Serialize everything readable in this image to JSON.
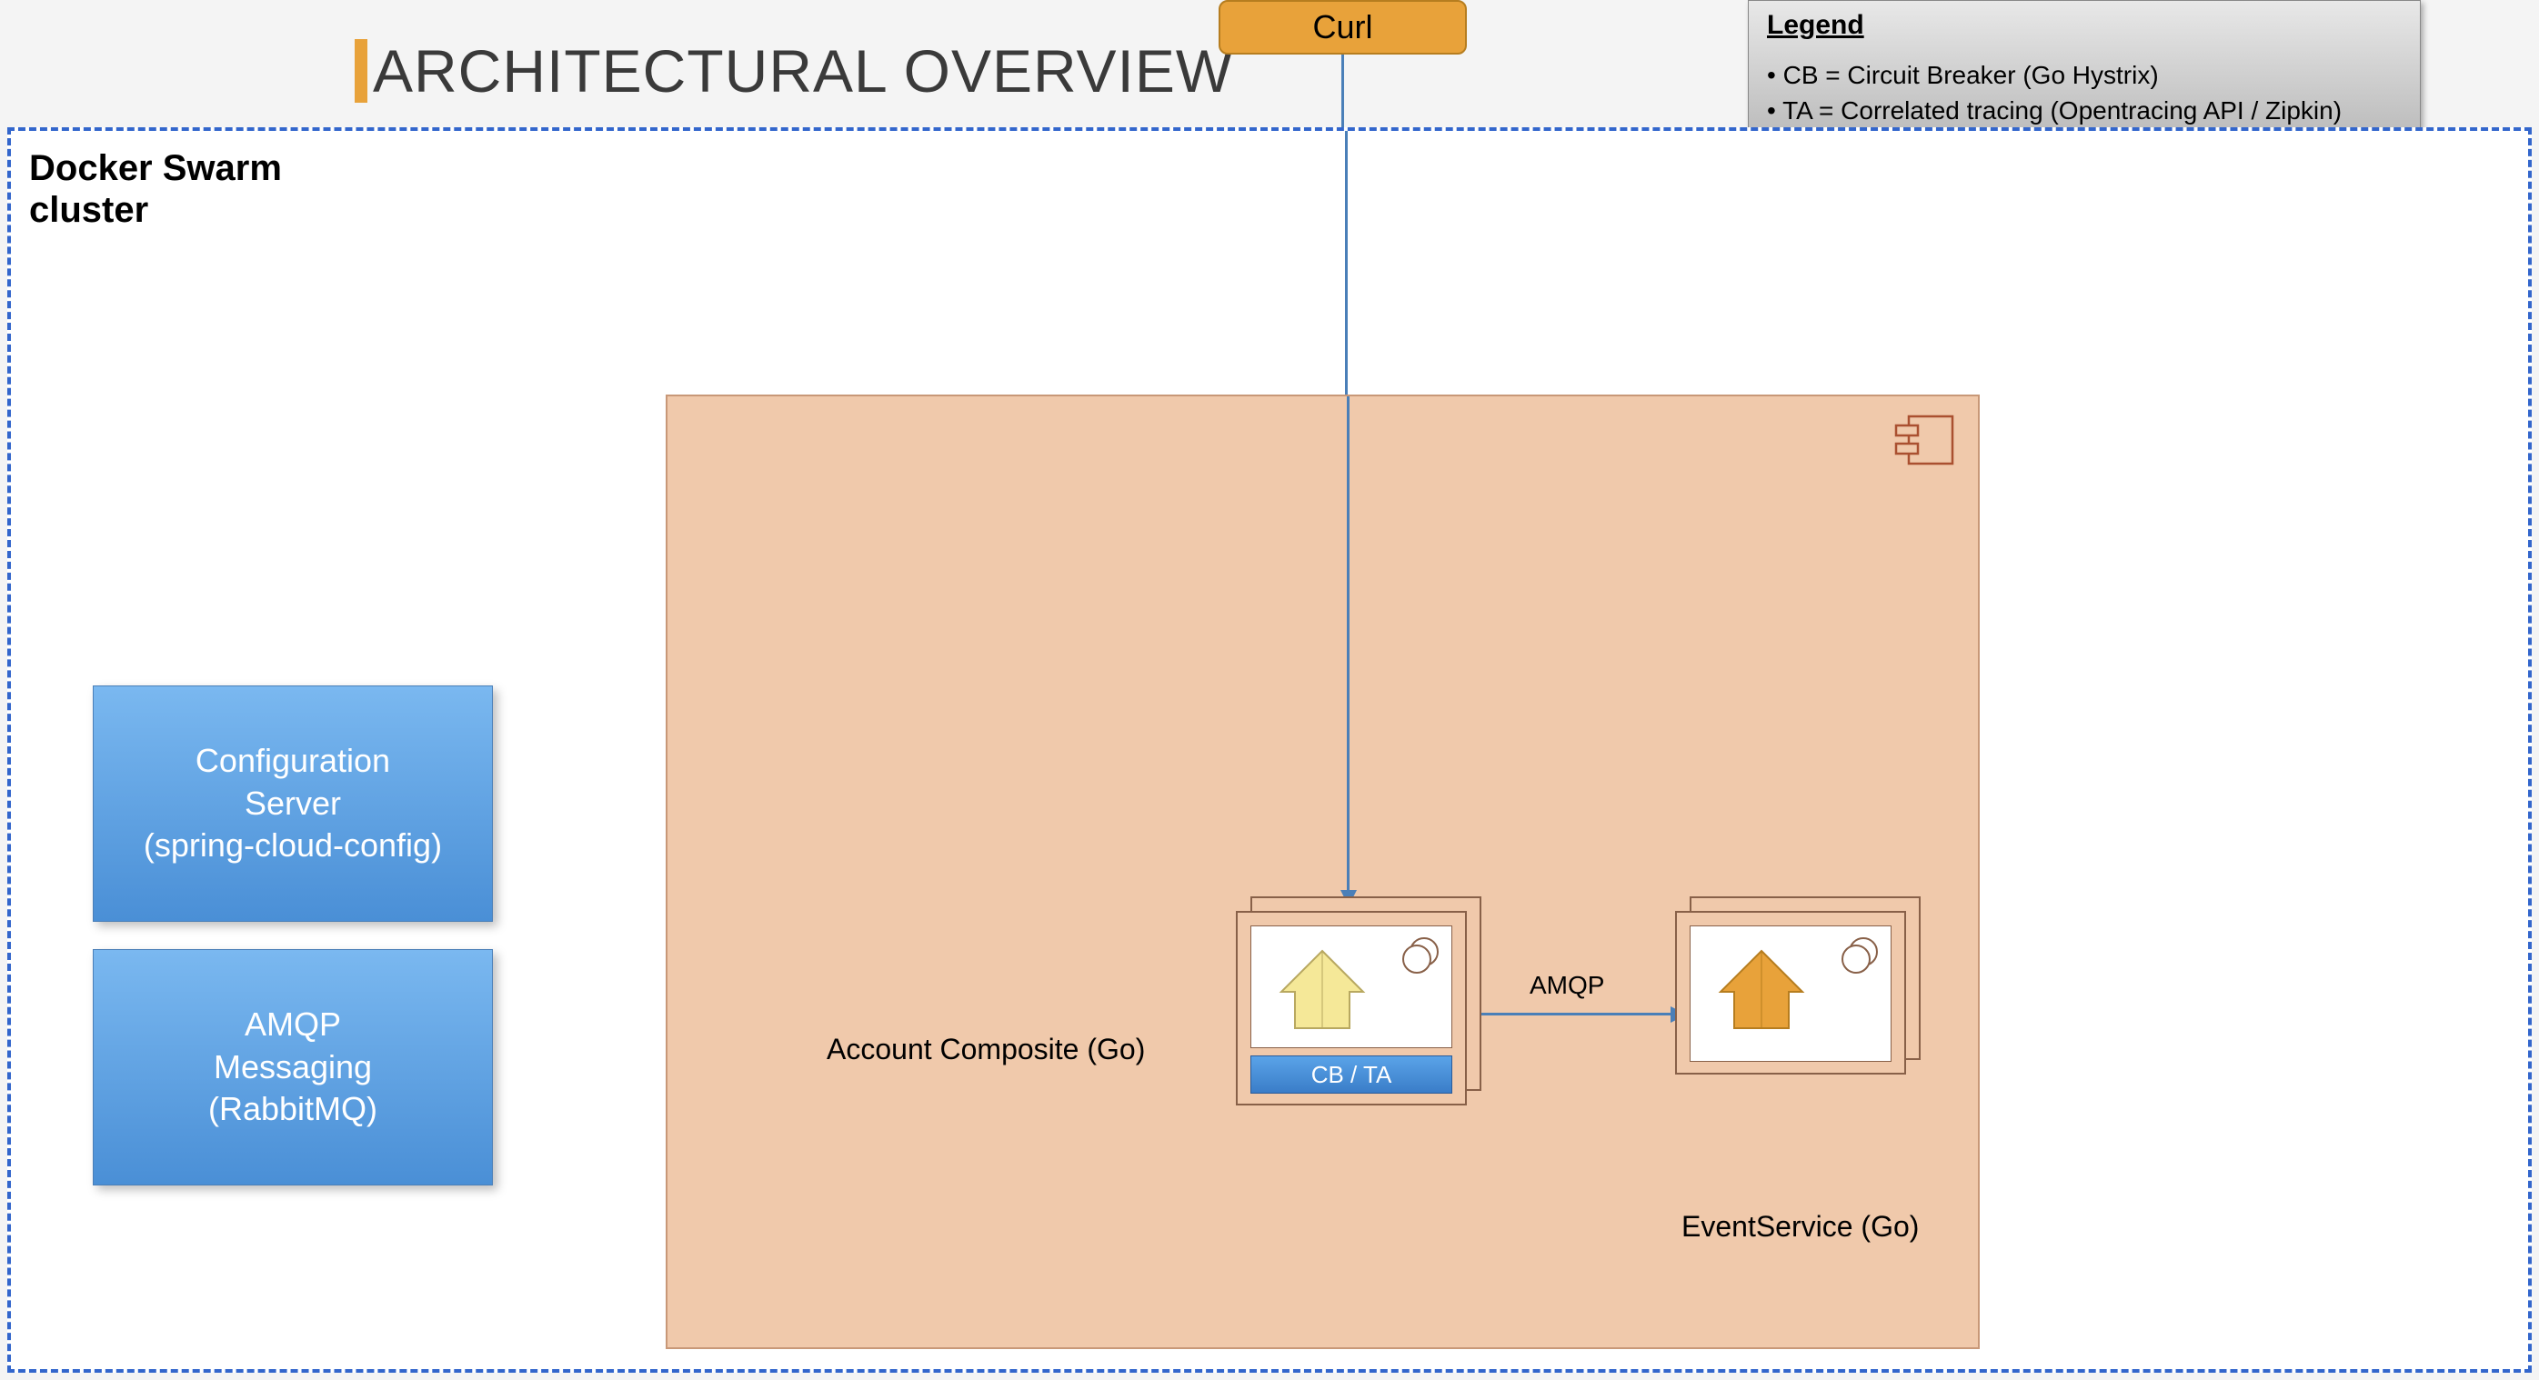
{
  "title": "ARCHITECTURAL OVERVIEW",
  "curl_label": "Curl",
  "legend": {
    "title": "Legend",
    "items": [
      "CB = Circuit Breaker (Go Hystrix)",
      "TA = Correlated tracing (Opentracing API / Zipkin)"
    ]
  },
  "swarm_cluster_label": "Docker Swarm\ncluster",
  "sidebar_services": {
    "config_server": "Configuration\nServer\n(spring-cloud-config)",
    "amqp": "AMQP\nMessaging\n(RabbitMQ)"
  },
  "nodes": {
    "account_composite": {
      "label": "Account Composite (Go)",
      "badge": "CB / TA"
    },
    "event_service": {
      "label": "EventService (Go)"
    }
  },
  "connections": {
    "amqp_label": "AMQP"
  }
}
